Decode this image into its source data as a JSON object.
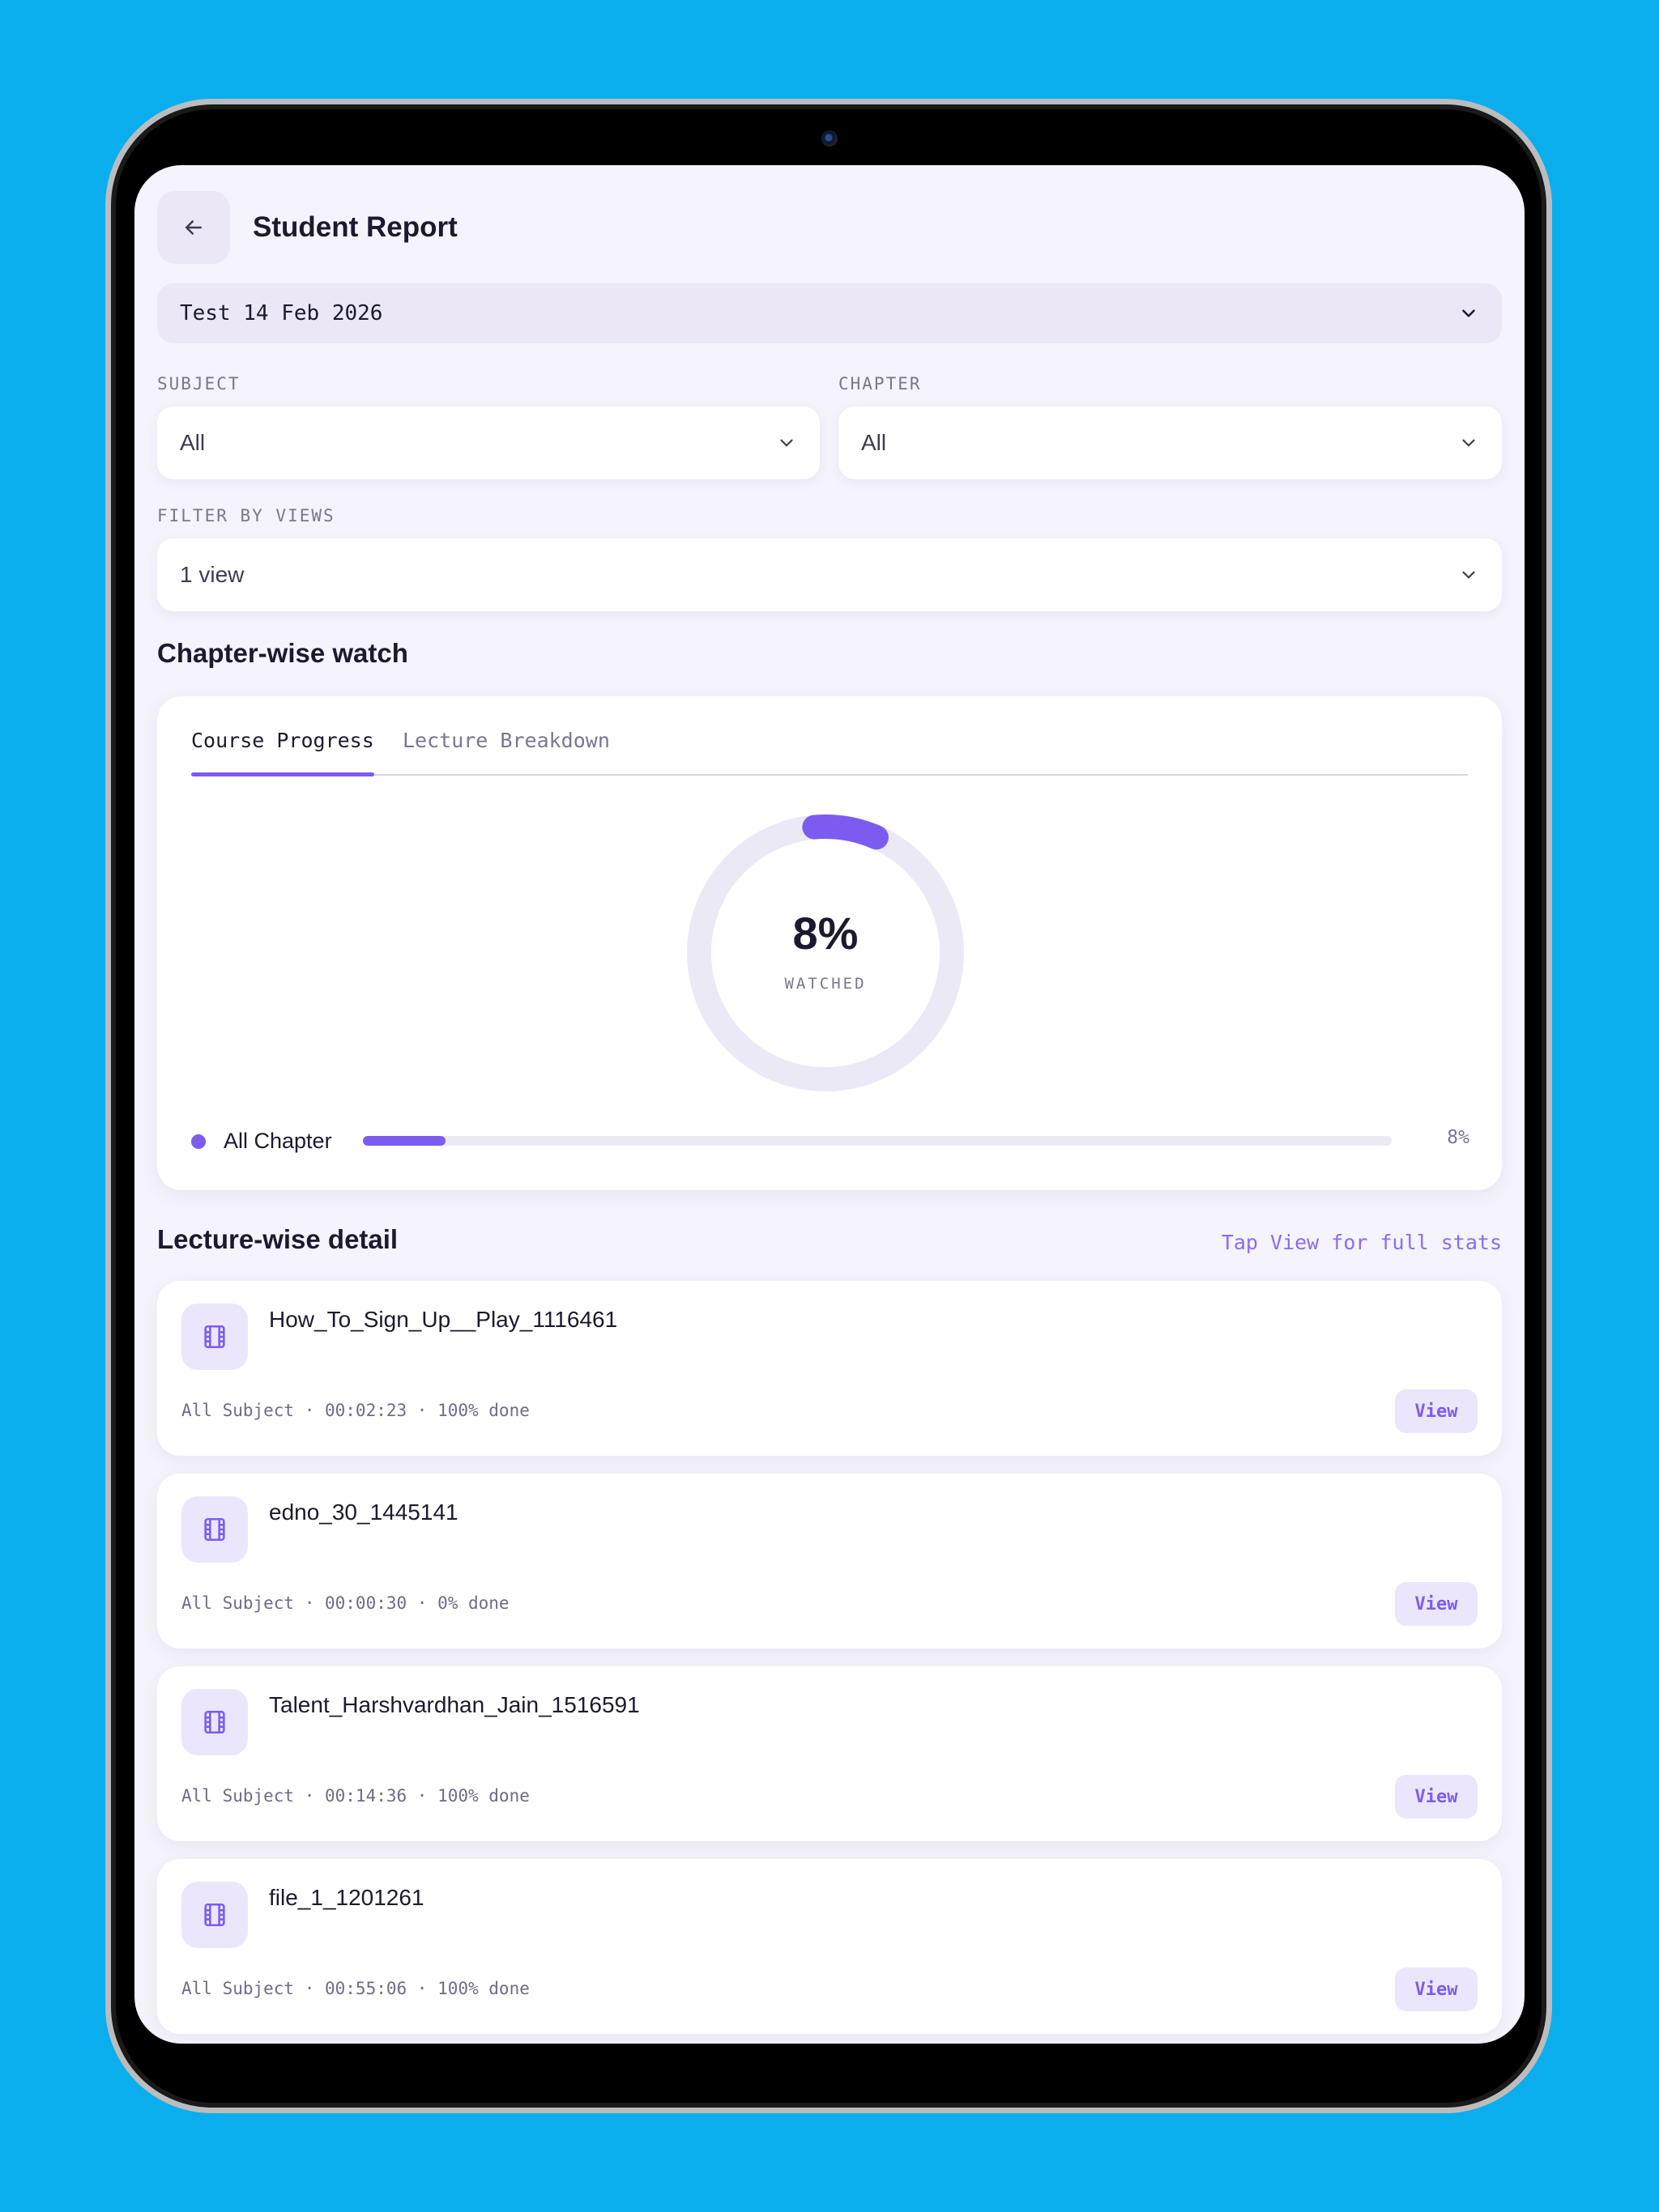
{
  "header": {
    "title": "Student Report"
  },
  "test_select": {
    "value": "Test 14 Feb 2026"
  },
  "filters": {
    "subject": {
      "label": "SUBJECT",
      "value": "All"
    },
    "chapter": {
      "label": "CHAPTER",
      "value": "All"
    },
    "views": {
      "label": "FILTER BY VIEWS",
      "value": "1 view"
    }
  },
  "chapter_section": {
    "title": "Chapter-wise watch",
    "tabs": [
      {
        "label": "Course Progress",
        "active": true
      },
      {
        "label": "Lecture Breakdown",
        "active": false
      }
    ],
    "donut": {
      "value": "8%",
      "fraction": 0.08,
      "sub": "WATCHED"
    },
    "legend": {
      "label": "All Chapter",
      "fraction": 0.08,
      "value": "8%"
    }
  },
  "lecture_section": {
    "title": "Lecture-wise detail",
    "hint": "Tap View for full stats",
    "view_label": "View",
    "items": [
      {
        "title": "How_To_Sign_Up__Play_1116461",
        "meta": "All Subject · 00:02:23 · 100% done"
      },
      {
        "title": "edno_30_1445141",
        "meta": "All Subject · 00:00:30 · 0% done"
      },
      {
        "title": "Talent_Harshvardhan_Jain_1516591",
        "meta": "All Subject · 00:14:36 · 100% done"
      },
      {
        "title": "file_1_1201261",
        "meta": "All Subject · 00:55:06 · 100% done"
      }
    ]
  },
  "colors": {
    "accent": "#7c5cf0",
    "track": "#ece9f7",
    "background": "#0aaeec"
  },
  "icons": {
    "back": "arrow-left-icon",
    "chevron": "chevron-down-icon",
    "lecture": "film-icon"
  }
}
